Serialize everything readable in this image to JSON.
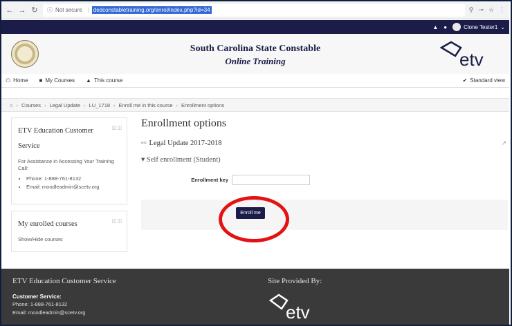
{
  "browser": {
    "security_label": "Not secure",
    "url": "dedconstabletraining.org/enrol/index.php?id=34"
  },
  "topbar": {
    "user_name": "Clone Tester1"
  },
  "header": {
    "title": "South Carolina State Constable",
    "subtitle": "Online Training",
    "logo_text": "etv"
  },
  "menu": {
    "home": "Home",
    "my_courses": "My Courses",
    "this_course": "This course",
    "standard_view": "Standard view"
  },
  "breadcrumb": {
    "items": [
      "Courses",
      "Legal Update",
      "LU_1718",
      "Enroll me in this course",
      "Enrollment options"
    ]
  },
  "block_service": {
    "title_line1": "ETV Education Customer",
    "title_line2": "Service",
    "assist_text": "For Assistance in Accessing Your Training Call:",
    "phone": "Phone: 1-888-761-8132",
    "email": "Email: moodleadmin@scetv.org"
  },
  "block_courses": {
    "title": "My enrolled courses",
    "toggle": "Show/Hide courses"
  },
  "main": {
    "title": "Enrollment options",
    "course_name": "Legal Update 2017-2018",
    "section": "Self enrollment (Student)",
    "key_label": "Enrollment key",
    "enroll_button": "Enroll me"
  },
  "footer": {
    "heading": "ETV Education Customer Service",
    "cs_label": "Customer Service:",
    "phone": "Phone: 1-888-761-8132",
    "email": "Email: moodleadmin@scetv.org",
    "provided_by": "Site Provided By:",
    "logo_text": "etv"
  },
  "colors": {
    "navy": "#1b1c48",
    "highlight_circle": "#e41212",
    "footer_bg": "#3a3a3a"
  }
}
